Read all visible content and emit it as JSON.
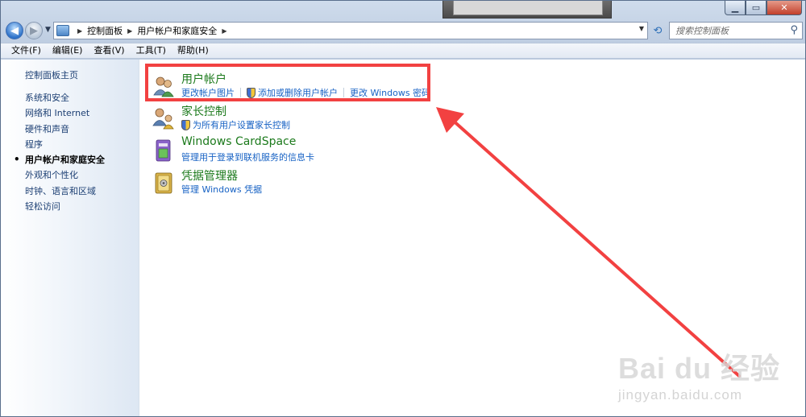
{
  "window": {
    "caption": {
      "minimize": "▁",
      "maximize": "▭",
      "close": "✕"
    }
  },
  "address_bar": {
    "breadcrumbs": [
      "控制面板",
      "用户帐户和家庭安全"
    ],
    "search_placeholder": "搜索控制面板"
  },
  "menu": {
    "items": [
      "文件(F)",
      "编辑(E)",
      "查看(V)",
      "工具(T)",
      "帮助(H)"
    ]
  },
  "sidebar": {
    "home": "控制面板主页",
    "items": [
      "系统和安全",
      "网络和 Internet",
      "硬件和声音",
      "程序",
      "用户帐户和家庭安全",
      "外观和个性化",
      "时钟、语言和区域",
      "轻松访问"
    ],
    "current_index": 4
  },
  "categories": [
    {
      "title": "用户帐户",
      "icon": "user-accounts-icon",
      "links": [
        {
          "label": "更改帐户图片",
          "shield": false
        },
        {
          "label": "添加或删除用户帐户",
          "shield": true
        },
        {
          "label": "更改 Windows 密码",
          "shield": false
        }
      ]
    },
    {
      "title": "家长控制",
      "icon": "parental-controls-icon",
      "links": [
        {
          "label": "为所有用户设置家长控制",
          "shield": true
        }
      ]
    },
    {
      "title": "Windows CardSpace",
      "icon": "cardspace-icon",
      "links": [
        {
          "label": "管理用于登录到联机服务的信息卡",
          "shield": false
        }
      ]
    },
    {
      "title": "凭据管理器",
      "icon": "credential-manager-icon",
      "links": [
        {
          "label": "管理 Windows 凭据",
          "shield": false
        }
      ]
    }
  ],
  "annotation": {
    "highlight_color": "#f24141",
    "arrow_color": "#f24141"
  },
  "watermark": {
    "brand": "Bai du 经验",
    "url": "jingyan.baidu.com"
  },
  "colors": {
    "category_title": "#1c7a1c",
    "task_link": "#1762c4",
    "sidebar_link": "#1c3f73"
  }
}
